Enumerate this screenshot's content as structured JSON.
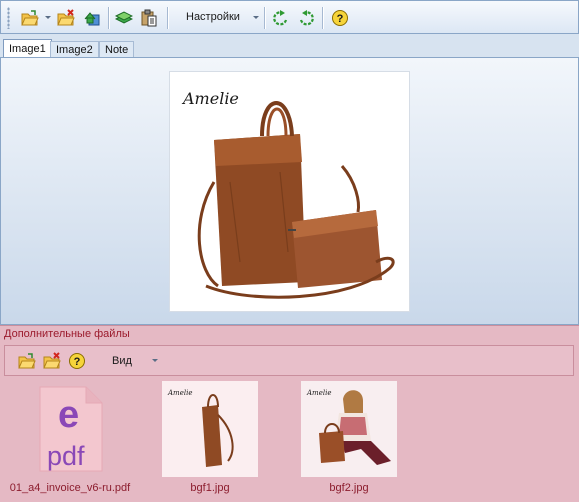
{
  "toolbar": {
    "icons": [
      "open-folder-icon",
      "open-folder-cancel-icon",
      "export-icon",
      "layers-icon",
      "paste-icon",
      "rotate-left-icon",
      "rotate-right-icon",
      "help-icon"
    ],
    "settings_label": "Настройки"
  },
  "tabs": [
    {
      "label": "Image1",
      "active": true
    },
    {
      "label": "Image2",
      "active": false
    },
    {
      "label": "Note",
      "active": false
    }
  ],
  "preview": {
    "brand": "Amelie"
  },
  "files": {
    "title": "Дополнительные файлы",
    "view_label": "Вид",
    "items": [
      {
        "name": "01_a4_invoice_v6-ru.pdf",
        "type": "pdf",
        "icon_text": "pdf"
      },
      {
        "name": "bgf1.jpg",
        "type": "image"
      },
      {
        "name": "bgf2.jpg",
        "type": "image"
      }
    ]
  },
  "colors": {
    "accent": "#9b1a2c",
    "toolbar_bg": "#dce7f4",
    "files_bg": "#e5b9c4",
    "leather": "#9a4f28"
  }
}
